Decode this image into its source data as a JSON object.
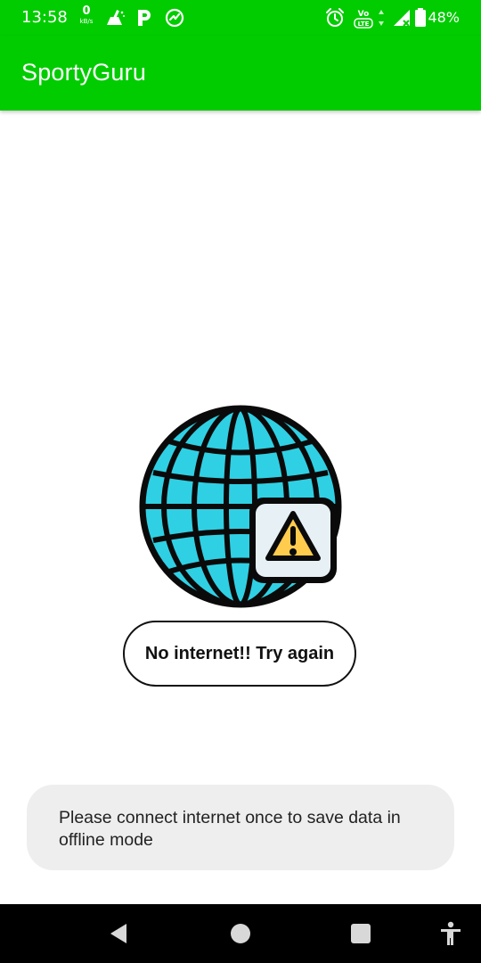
{
  "status_bar": {
    "time": "13:58",
    "net_speed_value": "0",
    "net_speed_unit": "kB/s",
    "battery_percent": "48%",
    "icons": [
      "cleaner-icon",
      "parking-p-icon",
      "speedometer-icon",
      "alarm-icon",
      "volte-lte-icon",
      "data-arrows-icon",
      "signal-icon",
      "battery-icon"
    ]
  },
  "app_bar": {
    "title": "SportyGuru"
  },
  "content": {
    "illustration": "globe-warning-icon",
    "retry_button_label": "No internet!! Try again"
  },
  "toast": {
    "message": "Please connect internet once to save data in offline mode"
  },
  "nav_bar": {
    "icons": [
      "back-icon",
      "home-icon",
      "recents-icon",
      "accessibility-icon"
    ]
  },
  "colors": {
    "primary": "#00cc00",
    "globe_fill": "#2fd0e4",
    "warning_yellow": "#ffcc4d",
    "toast_bg": "#eeeeee",
    "nav_bg": "#000000"
  }
}
